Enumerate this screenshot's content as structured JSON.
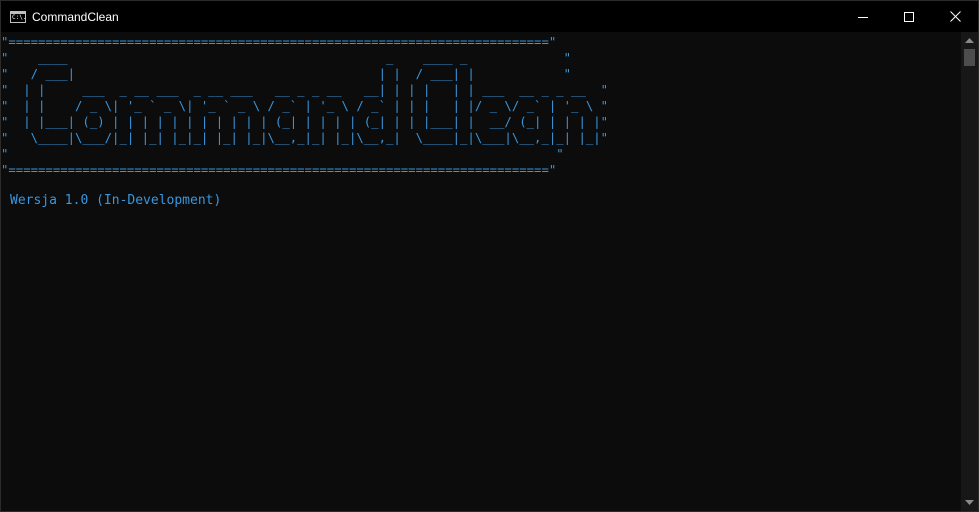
{
  "window": {
    "title": "CommandClean",
    "icon": "console-icon",
    "icon_glyph": "C:\\."
  },
  "controls": {
    "minimize": "minimize-icon",
    "maximize": "maximize-icon",
    "close": "close-icon"
  },
  "console": {
    "banner": "\"=========================================================================\"\n\"    ____                                           _    ____ _             \"\n\"   / ___|                                         | |  / ___| |            \"\n\"  | |     ___  _ __ ___  _ __ ___   __ _ _ __   __| | | |   | | ___  __ _ _ __  \"\n\"  | |    / _ \\| '_ ` _ \\| '_ ` _ \\ / _` | '_ \\ / _` | | |   | |/ _ \\/ _` | '_ \\ \"\n\"  | |___| (_) | | | | | | | | | | | (_| | | | | (_| | | |___| |  __/ (_| | | | |\"\n\"   \\____|\\___/|_| |_| |_|_| |_| |_|\\__,_|_| |_|\\__,_|  \\____|_|\\___|\\__,_|_| |_|\"\n\"                                                                          \"\n\"=========================================================================\"",
    "version_line": "Wersja 1.0 (In-Development)",
    "text_color": "#3a96dd",
    "background": "#0c0c0c"
  }
}
